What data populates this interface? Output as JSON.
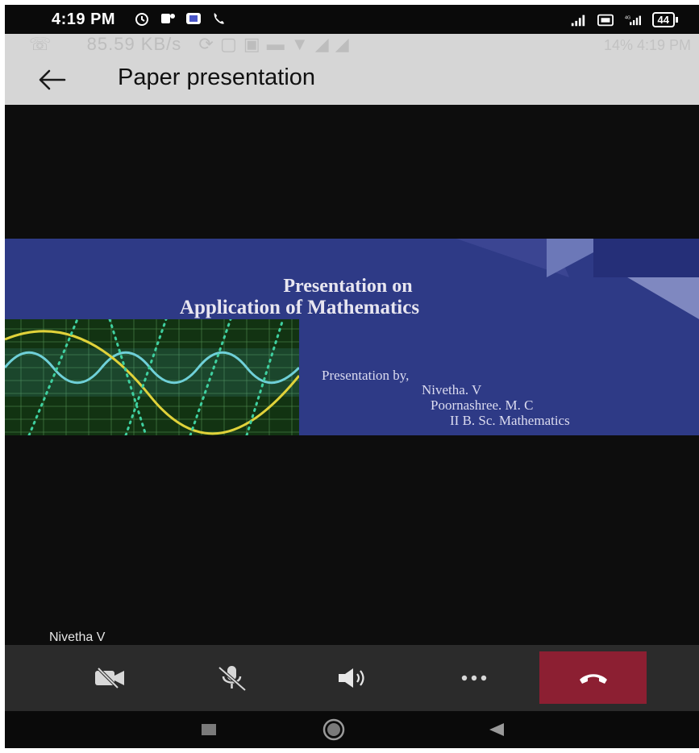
{
  "status_bar": {
    "time": "4:19 PM",
    "battery": "44",
    "left_icons": [
      "alarm-icon",
      "teams-icon",
      "teams-icon",
      "call-icon"
    ],
    "right_icons": [
      "signal-icon",
      "volte-icon",
      "4g-signal-icon",
      "battery-icon"
    ]
  },
  "ghost_overlay": {
    "speed": "85.59 KB/s",
    "right": "14%  4:19 PM"
  },
  "app_bar": {
    "back_icon": "back-arrow-icon",
    "title": "Paper presentation"
  },
  "slide": {
    "title_line1": "Presentation on",
    "title_line2": "Application of Mathematics",
    "presented_by": "Presentation by,",
    "presenters": [
      "Nivetha. V",
      "Poornashree. M. C",
      "II B. Sc.  Mathematics"
    ],
    "colors": {
      "background": "#2e3a86",
      "wave_bg": "#123312"
    }
  },
  "participant_name": "Nivetha V",
  "controls": {
    "camera_off_icon": "camera-off-icon",
    "mic_off_icon": "mic-off-icon",
    "speaker_icon": "speaker-icon",
    "more_icon": "more-icon",
    "hangup_icon": "hangup-icon",
    "hangup_color": "#8c1f32"
  },
  "nav_bar": {
    "recents_icon": "recents-icon",
    "home_icon": "home-icon",
    "back_icon": "nav-back-icon"
  }
}
